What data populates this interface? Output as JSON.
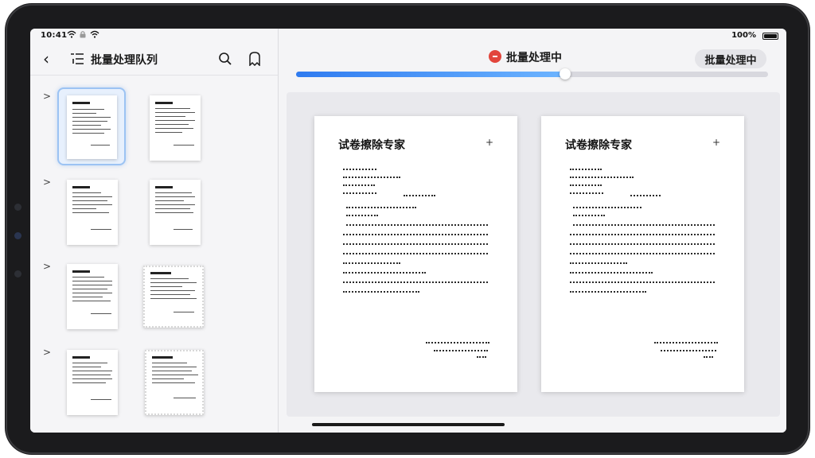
{
  "status": {
    "time": "10:41",
    "battery": "100%"
  },
  "sidebar": {
    "title": "批量处理队列",
    "groups": [
      {
        "chevron": ">"
      },
      {
        "chevron": ">"
      },
      {
        "chevron": ">"
      },
      {
        "chevron": ">"
      }
    ]
  },
  "main": {
    "processing_label": "批量处理中",
    "processing_button": "批量处理中",
    "progress": 0.57
  },
  "pages": [
    {
      "title": "试卷擦除专家",
      "plus": "+"
    },
    {
      "title": "试卷擦除专家",
      "plus": "+"
    }
  ],
  "colors": {
    "accent": "#2f7bf0",
    "status_dot": "#e2453c",
    "selected_border": "#9cc3f3"
  },
  "icons": [
    "back-icon",
    "queue-list-icon",
    "search-icon",
    "bookmark-icon",
    "processing-icon",
    "wifi-icon",
    "battery-icon"
  ]
}
